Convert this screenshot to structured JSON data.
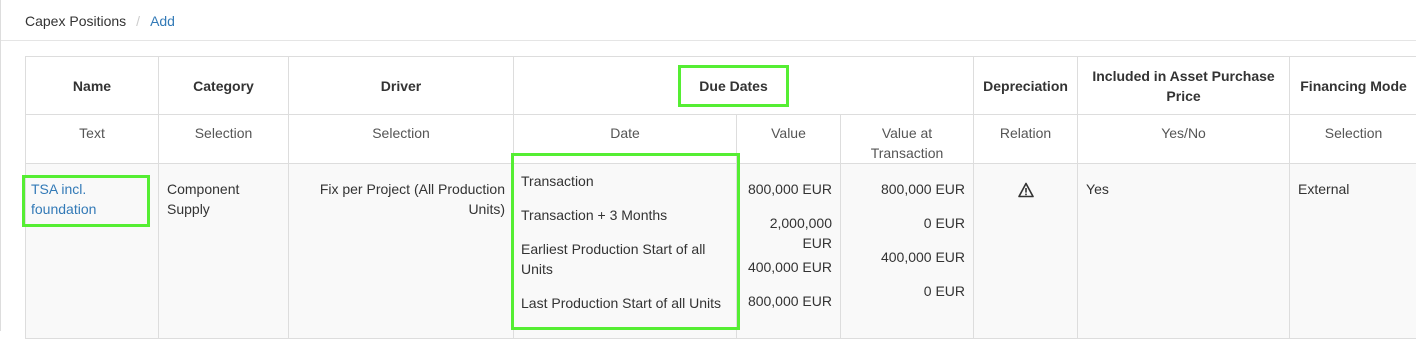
{
  "breadcrumb": {
    "current": "Capex Positions",
    "separator": "/",
    "action": "Add"
  },
  "table": {
    "headers": {
      "name": "Name",
      "category": "Category",
      "driver": "Driver",
      "due_dates": "Due Dates",
      "depreciation": "Depreciation",
      "included": "Included in Asset Purchase Price",
      "financing": "Financing Mode"
    },
    "subheaders": {
      "name": "Text",
      "category": "Selection",
      "driver": "Selection",
      "date": "Date",
      "value": "Value",
      "value_at_transaction": "Value at Transaction",
      "depreciation": "Relation",
      "included": "Yes/No",
      "financing": "Selection"
    },
    "row": {
      "name": "TSA incl. foundation",
      "category": "Component Supply",
      "driver": "Fix per Project (All Production Units)",
      "dates": [
        "Transaction",
        "Transaction + 3 Months",
        "Earliest Production Start of all Units",
        "Last Production Start of all Units"
      ],
      "values": [
        "800,000 EUR",
        "2,000,000 EUR",
        "400,000 EUR",
        "800,000 EUR"
      ],
      "values_at_transaction": [
        "800,000 EUR",
        "0 EUR",
        "400,000 EUR",
        "0 EUR"
      ],
      "depreciation_icon": "warning-triangle-icon",
      "included": "Yes",
      "financing": "External"
    }
  },
  "colors": {
    "highlight": "#55ee33",
    "link": "#337ab7",
    "row_bg": "#f9f9f9",
    "border": "#dddddd"
  }
}
